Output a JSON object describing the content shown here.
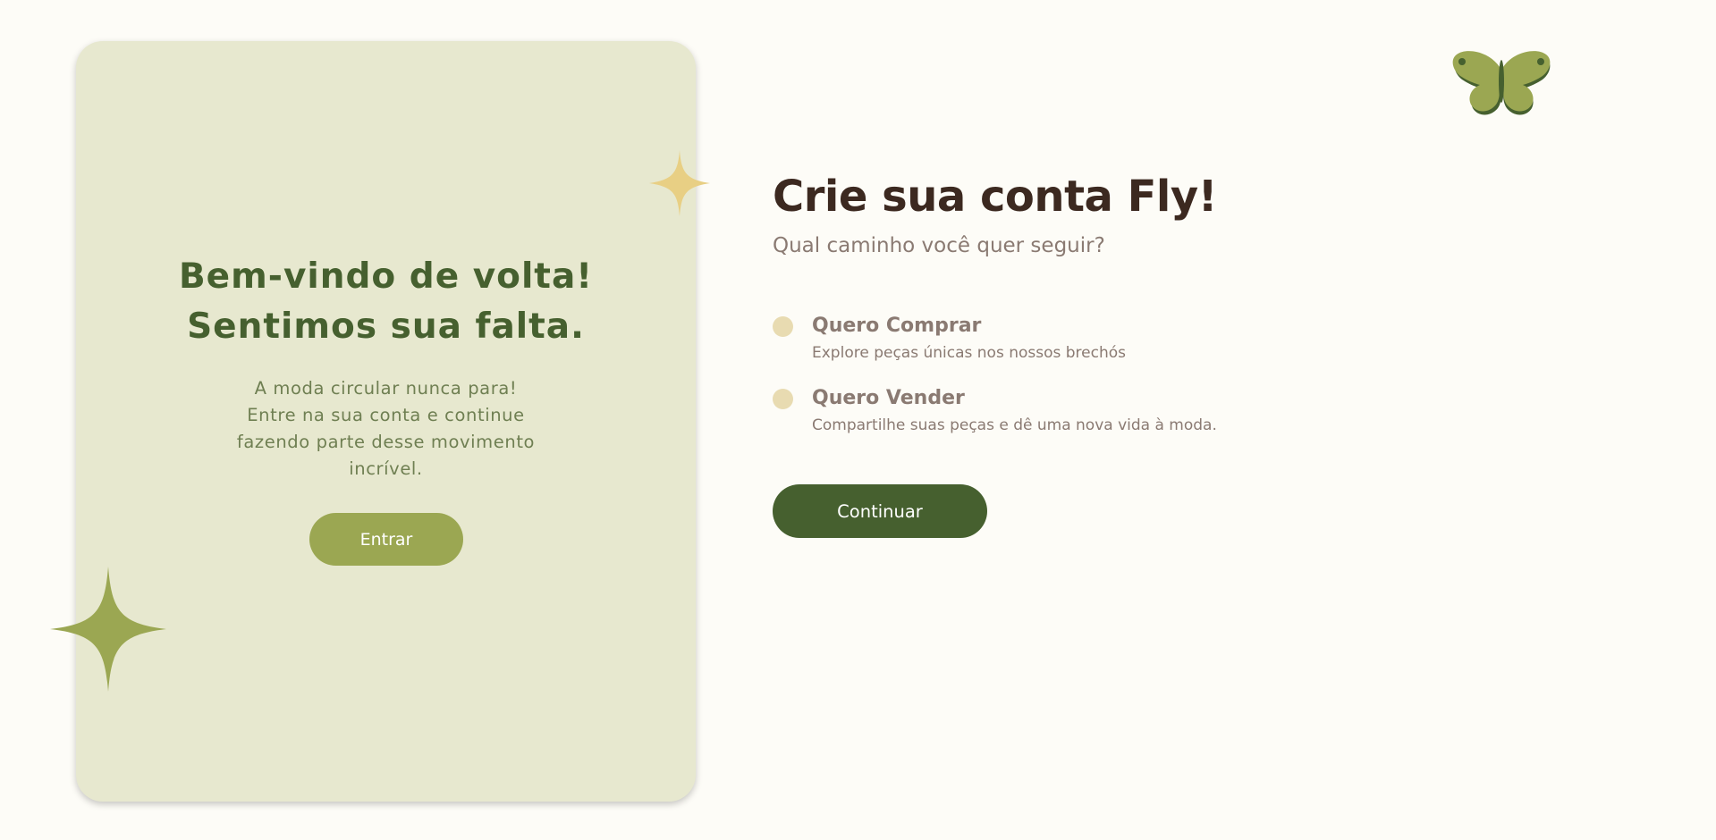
{
  "welcome": {
    "title_line1": "Bem-vindo de volta!",
    "title_line2": "Sentimos sua falta.",
    "text_line1": "A moda circular nunca para!",
    "text_line2": "Entre na sua conta e continue",
    "text_line3": "fazendo parte desse movimento",
    "text_line4": "incrível.",
    "enter_label": "Entrar"
  },
  "signup": {
    "title": "Crie sua conta Fly!",
    "subtitle": "Qual caminho você quer seguir?",
    "options": [
      {
        "title": "Quero Comprar",
        "description": "Explore peças únicas nos nossos brechós",
        "selected": false
      },
      {
        "title": "Quero Vender",
        "description": "Compartilhe suas peças e dê uma nova vida à moda.",
        "selected": false
      }
    ],
    "continue_label": "Continuar"
  },
  "icons": {
    "logo": "butterfly-icon",
    "decor_small": "sparkle-icon",
    "decor_large": "sparkle-icon"
  },
  "colors": {
    "background": "#fdfcf7",
    "card": "#e7e8cf",
    "primary_green": "#46602f",
    "olive": "#9ba752",
    "sparkle_gold": "#e8cf84",
    "radio": "#e8dbb1",
    "title_brown": "#3c2920",
    "muted_text": "#8a7a72"
  }
}
